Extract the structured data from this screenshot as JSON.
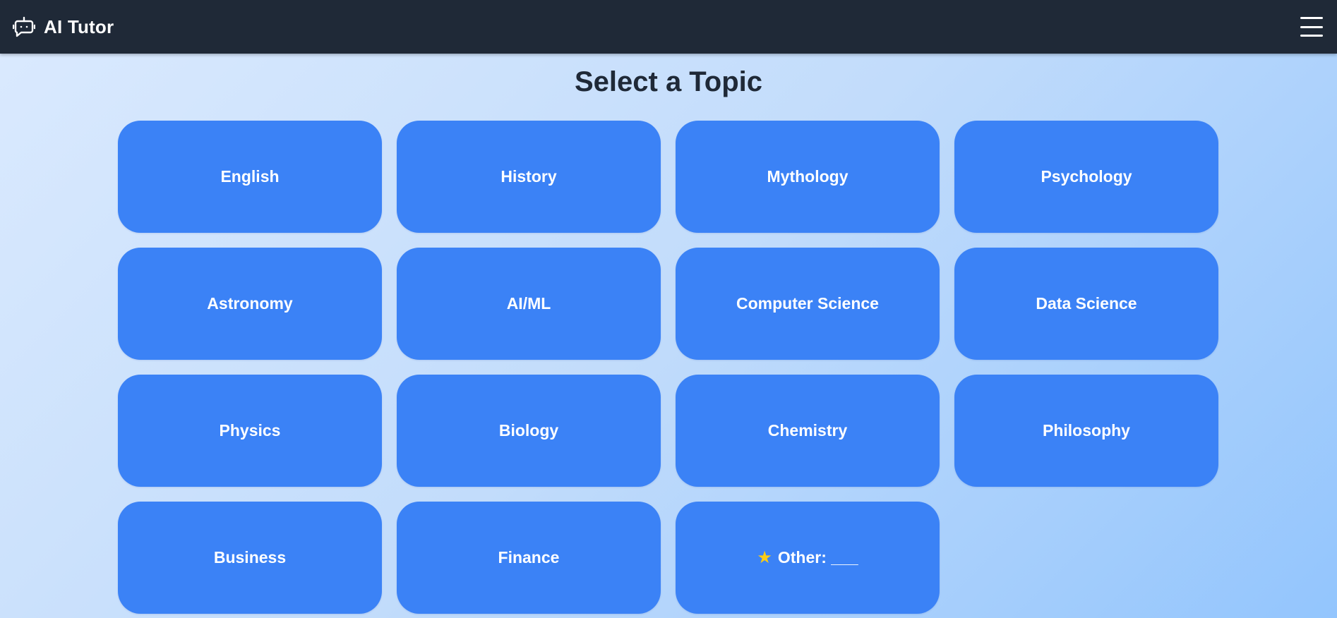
{
  "header": {
    "brand": "AI Tutor",
    "logo_icon": "bot-chat-icon",
    "menu_icon": "hamburger-menu-icon"
  },
  "main": {
    "title": "Select a Topic",
    "topics": [
      {
        "label": "English"
      },
      {
        "label": "History"
      },
      {
        "label": "Mythology"
      },
      {
        "label": "Psychology"
      },
      {
        "label": "Astronomy"
      },
      {
        "label": "AI/ML"
      },
      {
        "label": "Computer Science"
      },
      {
        "label": "Data Science"
      },
      {
        "label": "Physics"
      },
      {
        "label": "Biology"
      },
      {
        "label": "Chemistry"
      },
      {
        "label": "Philosophy"
      },
      {
        "label": "Business"
      },
      {
        "label": "Finance"
      },
      {
        "label": "Other: ___",
        "icon": "star-icon",
        "icon_glyph": "★"
      }
    ]
  },
  "colors": {
    "navbar": "#1f2937",
    "topic_button": "#3b82f6",
    "title": "#1f2937",
    "star": "#facc15"
  }
}
